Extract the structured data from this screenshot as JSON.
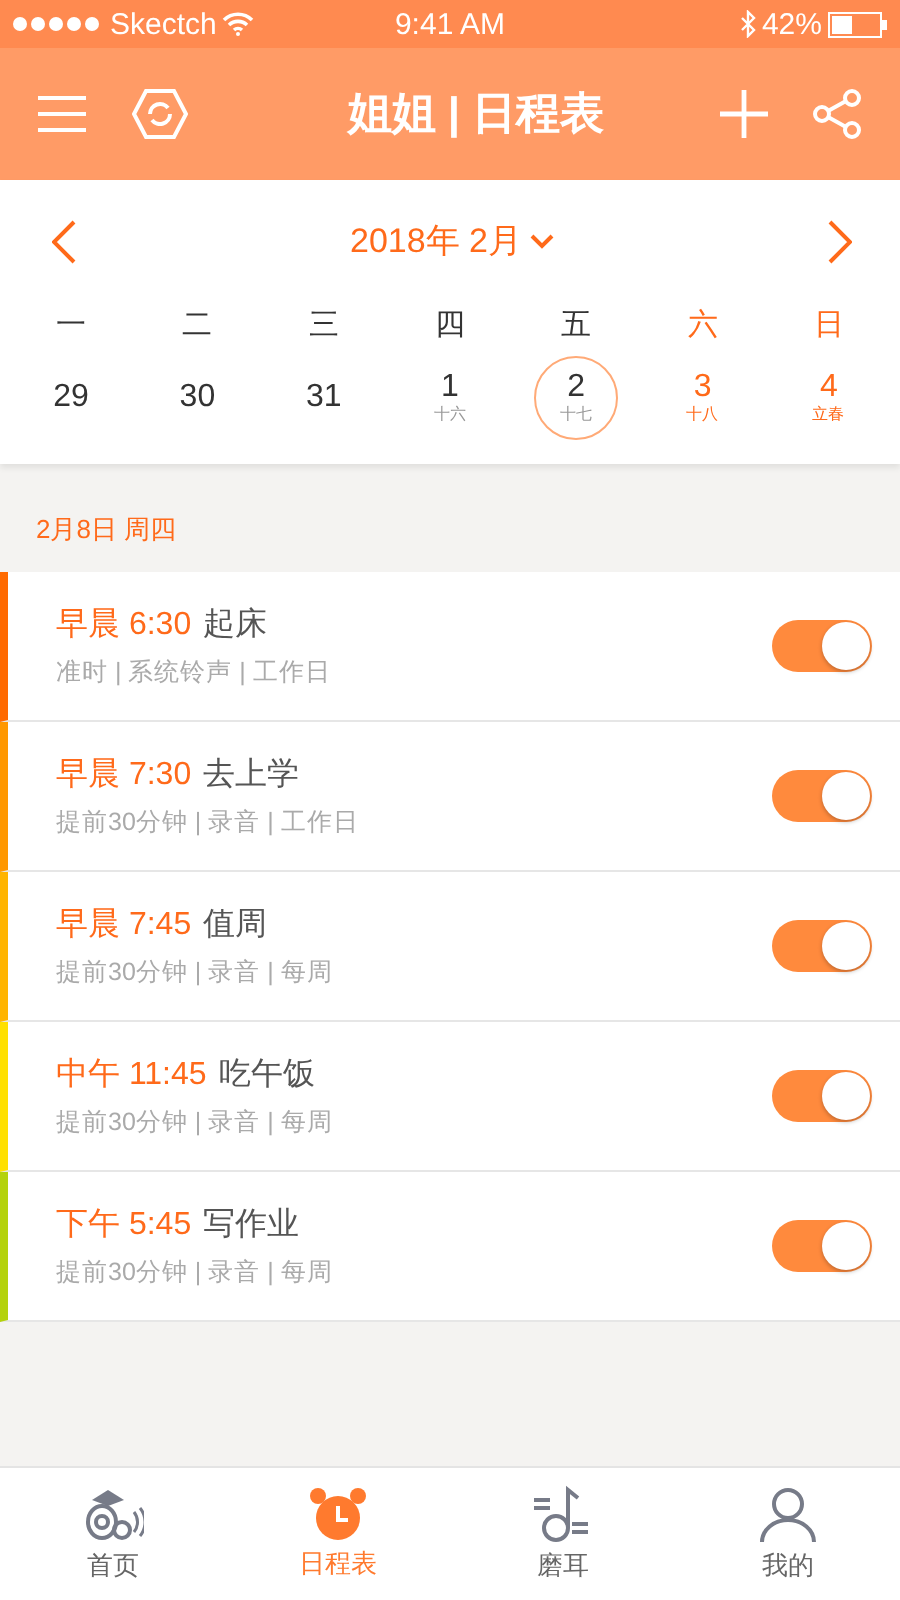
{
  "status_bar": {
    "carrier": "Skectch",
    "time": "9:41 AM",
    "battery": "42%"
  },
  "nav": {
    "title": "姐姐 | 日程表"
  },
  "calendar": {
    "month": "2018年 2月",
    "weekdays": [
      {
        "label": "一",
        "weekend": false
      },
      {
        "label": "二",
        "weekend": false
      },
      {
        "label": "三",
        "weekend": false
      },
      {
        "label": "四",
        "weekend": false
      },
      {
        "label": "五",
        "weekend": false
      },
      {
        "label": "六",
        "weekend": true
      },
      {
        "label": "日",
        "weekend": true
      }
    ],
    "days": [
      {
        "day": "29",
        "weekend": false,
        "selected": false
      },
      {
        "day": "30",
        "weekend": false,
        "selected": false
      },
      {
        "day": "31",
        "weekend": false,
        "selected": false
      },
      {
        "day": "1",
        "lunar": "十六",
        "weekend": false,
        "selected": false
      },
      {
        "day": "2",
        "lunar": "十七",
        "weekend": false,
        "selected": true
      },
      {
        "day": "3",
        "lunar": "十八",
        "weekend": true,
        "selected": false
      },
      {
        "day": "4",
        "lunar": "立春",
        "weekend": true,
        "selected": false
      }
    ]
  },
  "section_date": "2月8日  周四",
  "schedules": [
    {
      "time": "早晨 6:30",
      "title": "起床",
      "details": "准时 | 系统铃声 | 工作日",
      "color": "#ff6a00",
      "on": true
    },
    {
      "time": "早晨 7:30",
      "title": "去上学",
      "details": "提前30分钟 | 录音 | 工作日",
      "color": "#ff9800",
      "on": true
    },
    {
      "time": "早晨 7:45",
      "title": "值周",
      "details": "提前30分钟 | 录音 | 每周",
      "color": "#ffb400",
      "on": true
    },
    {
      "time": "中午 11:45",
      "title": "吃午饭",
      "details": "提前30分钟 | 录音 | 每周",
      "color": "#ffe000",
      "on": true
    },
    {
      "time": "下午 5:45",
      "title": "写作业",
      "details": "提前30分钟 | 录音 | 每周",
      "color": "#b4d20c",
      "on": true
    }
  ],
  "tabs": [
    {
      "label": "首页",
      "kind": "home",
      "selected": false
    },
    {
      "label": "日程表",
      "kind": "clock",
      "selected": true
    },
    {
      "label": "磨耳",
      "kind": "music",
      "selected": false
    },
    {
      "label": "我的",
      "kind": "user",
      "selected": false
    }
  ]
}
